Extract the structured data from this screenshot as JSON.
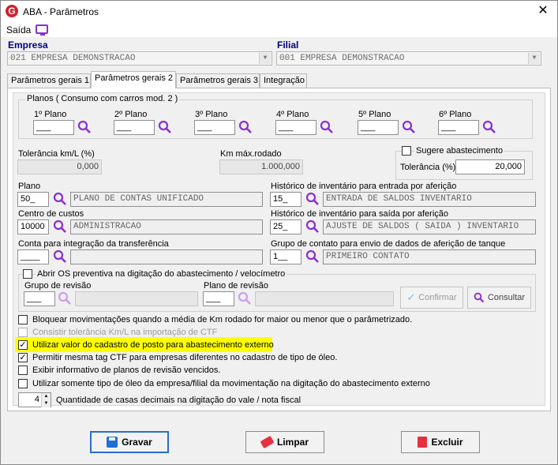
{
  "window": {
    "title": "ABA - Parâmetros",
    "app_icon": "G"
  },
  "menu": {
    "saida": "Saída"
  },
  "empresa": {
    "label": "Empresa",
    "value": "021 EMPRESA DEMONSTRACAO"
  },
  "filial": {
    "label": "Filial",
    "value": "001 EMPRESA DEMONSTRACAO"
  },
  "tabs": [
    {
      "label": "Parâmetros gerais 1"
    },
    {
      "label": "Parâmetros gerais 2"
    },
    {
      "label": "Parâmetros gerais 3"
    },
    {
      "label": "Integração"
    }
  ],
  "planos": {
    "title": "Planos ( Consumo com carros mod. 2 )",
    "items": [
      {
        "label": "1º Plano",
        "value": "___"
      },
      {
        "label": "2º Plano",
        "value": "___"
      },
      {
        "label": "3º Plano",
        "value": "___"
      },
      {
        "label": "4º Plano",
        "value": "___"
      },
      {
        "label": "5º Plano",
        "value": "___"
      },
      {
        "label": "6º Plano",
        "value": "___"
      }
    ]
  },
  "tolerancia_km": {
    "label": "Tolerância km/L (%)",
    "value": "0,000"
  },
  "km_max": {
    "label": "Km máx.rodado",
    "value": "1.000,000"
  },
  "sugere": {
    "label": "Sugere abastecimento",
    "tol_label": "Tolerância (%)",
    "tol_value": "20,000"
  },
  "plano": {
    "label": "Plano",
    "code": "50_",
    "desc": "PLANO DE CONTAS UNIFICADO"
  },
  "hist_entrada": {
    "label": "Histórico de inventário para entrada por aferição",
    "code": "15_",
    "desc": "ENTRADA DE SALDOS INVENTARIO"
  },
  "centro_custos": {
    "label": "Centro de custos",
    "code": "10000",
    "desc": "ADMINISTRACAO"
  },
  "hist_saida": {
    "label": "Histórico de inventário para saída por aferição",
    "code": "25_",
    "desc": "AJUSTE DE SALDOS ( SAIDA ) INVENTARIO"
  },
  "conta_integracao": {
    "label": "Conta para integração da transferência",
    "code": "____",
    "desc": ""
  },
  "grupo_contato": {
    "label": "Grupo de contato para envio de dados de aferição de tanque",
    "code": "1__",
    "desc": "PRIMEIRO CONTATO"
  },
  "os_preventiva": {
    "label": "Abrir OS preventiva na digitação do abastecimento / velocímetro",
    "grupo_label": "Grupo de revisão",
    "grupo_code": "___",
    "plano_label": "Plano de revisão",
    "plano_code": "___",
    "confirmar": "Confirmar",
    "consultar": "Consultar"
  },
  "options": [
    {
      "label": "Bloquear movimentações quando a média de Km rodado for maior ou menor que o parâmetrizado.",
      "checked": false,
      "disabled": false
    },
    {
      "label": "Consistir tolerância Km/L na importação de CTF",
      "checked": false,
      "disabled": true
    },
    {
      "label": "Utilizar valor do cadastro de posto para abastecimento externo",
      "checked": true,
      "disabled": false
    },
    {
      "label": "Permitir mesma tag CTF para empresas diferentes no cadastro de tipo de óleo.",
      "checked": true,
      "disabled": false
    },
    {
      "label": "Exibir informativo de planos de revisão vencidos.",
      "checked": false,
      "disabled": false
    },
    {
      "label": "Utilizar somente tipo de óleo da empresa/filial da movimentação na digitação do abastecimento externo",
      "checked": false,
      "disabled": false
    }
  ],
  "casas_decimais": {
    "value": "4",
    "label": "Quantidade de casas decimais na digitação do vale / nota fiscal"
  },
  "buttons": {
    "gravar": "Gravar",
    "limpar": "Limpar",
    "excluir": "Excluir"
  },
  "colors": {
    "accent": "#000080",
    "icon": "#8b2fd0",
    "highlight": "#ffff00"
  }
}
